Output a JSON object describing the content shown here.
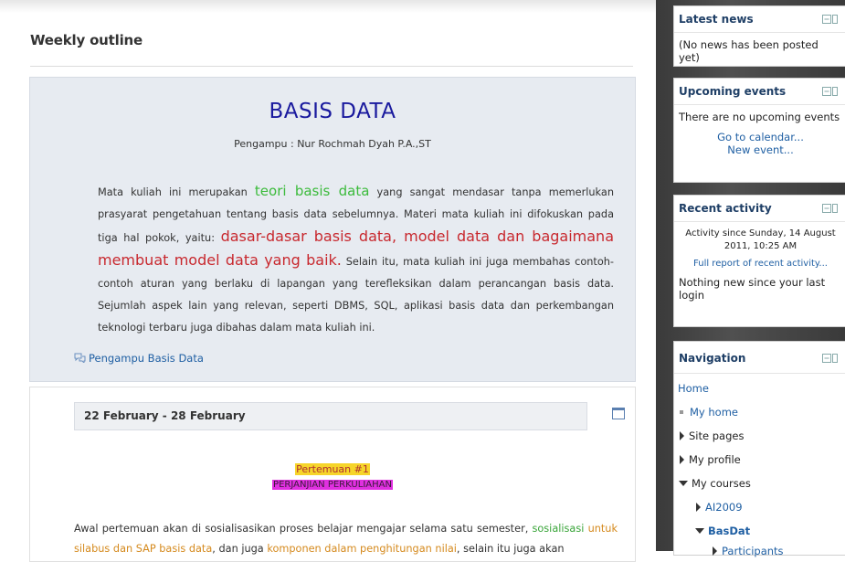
{
  "main": {
    "outline_title": "Weekly outline",
    "summary": {
      "course_title": "BASIS DATA",
      "lecturer": "Pengampu : Nur Rochmah Dyah P.A.,ST",
      "desc_part1": "Mata kuliah ini merupakan ",
      "desc_hl1": "teori basis data",
      "desc_part2": " yang sangat mendasar tanpa memerlukan prasyarat pengetahuan tentang basis data sebelumnya. Materi mata kuliah ini difokuskan pada tiga hal pokok, yaitu: ",
      "desc_hl2": "dasar-dasar basis data, model data dan bagaimana membuat model data yang baik.",
      "desc_part3": " Selain itu, mata kuliah ini juga membahas contoh-contoh aturan yang berlaku di lapangan yang terefleksikan dalam perancangan basis data. Sejumlah aspek lain yang relevan, seperti DBMS, SQL, aplikasi basis data dan perkembangan teknologi terbaru juga dibahas dalam mata kuliah ini.",
      "forum_link": "Pengampu Basis Data"
    },
    "week": {
      "heading": "22 February - 28 February",
      "meeting": "Pertemuan #1",
      "meeting_subtitle": "PERJANJIAN PERKULIAHAN",
      "desc_part1": "Awal pertemuan akan di sosialisasikan proses belajar mengajar selama satu semester, ",
      "desc_hl1": "sosialisasi",
      "desc_hl2": "untuk silabus dan SAP basis data",
      "desc_part2": ", dan juga ",
      "desc_hl3": "komponen dalam penghitungan nilai",
      "desc_part3": ", selain itu juga akan"
    }
  },
  "sidebar": {
    "latest_news": {
      "title": "Latest news",
      "body": "(No news has been posted yet)"
    },
    "upcoming_events": {
      "title": "Upcoming events",
      "body": "There are no upcoming events",
      "link_calendar": "Go to calendar...",
      "link_new_event": "New event..."
    },
    "recent_activity": {
      "title": "Recent activity",
      "since": "Activity since Sunday, 14 August 2011, 10:25 AM",
      "full_report": "Full report of recent activity...",
      "nothing_new": "Nothing new since your last login"
    },
    "navigation": {
      "title": "Navigation",
      "home": "Home",
      "my_home": "My home",
      "site_pages": "Site pages",
      "my_profile": "My profile",
      "my_courses": "My courses",
      "course_ai": "AI2009",
      "course_basdat": "BasDat",
      "participants": "Participants"
    }
  },
  "colors": {
    "title_blue": "#1a1a9e",
    "highlight_green": "#3cbb3c",
    "highlight_red": "#c8282e",
    "link_blue": "#1f5fa3",
    "meeting_yellow": "#f6d52a",
    "meeting_magenta": "#e030e0"
  },
  "icons": {
    "forum": "forum-bubbles-icon",
    "block_control": "block-dock-icon",
    "week_toggle": "window-icon"
  }
}
